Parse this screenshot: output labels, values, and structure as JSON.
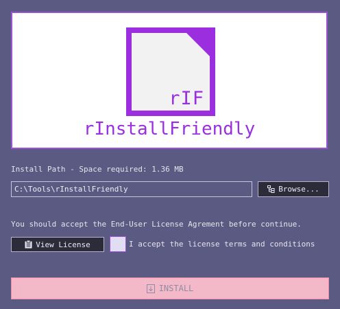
{
  "banner": {
    "logo_abbr": "rIF",
    "app_name": "rInstallFriendly"
  },
  "install_path": {
    "label": "Install Path - Space required: 1.36 MB",
    "value": "C:\\Tools\\rInstallFriendly",
    "browse_label": "Browse..."
  },
  "license": {
    "notice": "You should accept the End-User License Agrement before continue.",
    "view_label": "View License",
    "accept_label": "I accept the license terms and conditions",
    "accepted": false
  },
  "install": {
    "label": "INSTALL"
  },
  "colors": {
    "background": "#5b5a82",
    "accent": "#9b2fe0",
    "install_button": "#f4b9c9"
  }
}
